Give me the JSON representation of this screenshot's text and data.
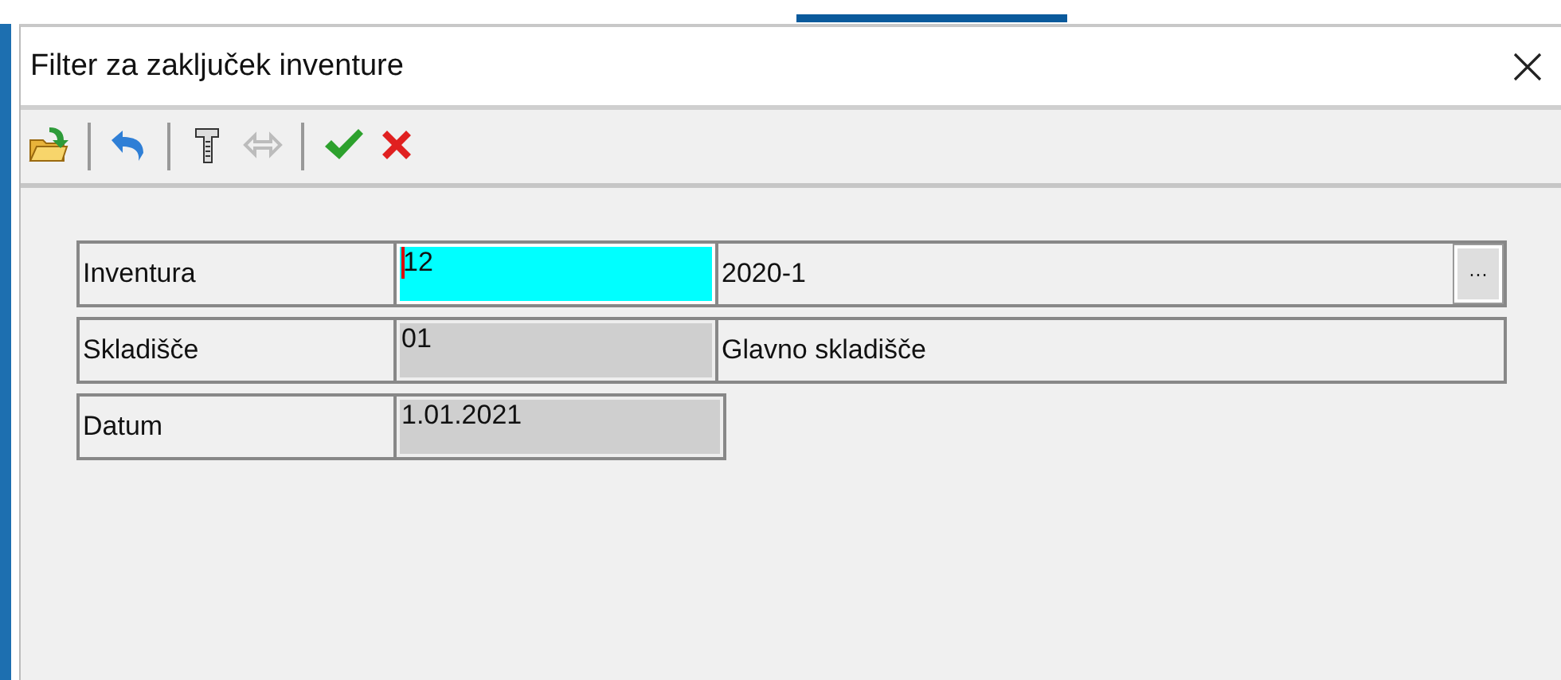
{
  "window": {
    "title": "Filter za zaključek inventure"
  },
  "toolbar": [
    [
      {
        "kind": "open",
        "disabled": false
      }
    ],
    [
      {
        "kind": "undo",
        "disabled": false
      }
    ],
    [
      {
        "kind": "tool",
        "disabled": false
      },
      {
        "kind": "link",
        "disabled": true
      }
    ],
    [
      {
        "kind": "confirm",
        "disabled": false
      },
      {
        "kind": "cancel",
        "disabled": false
      }
    ]
  ],
  "fields": [
    {
      "label": "Inventura",
      "code": "12",
      "focused": true,
      "disabled": false,
      "description": "2020-1",
      "lookup": "···"
    },
    {
      "label": "Skladišče",
      "code": "01",
      "focused": false,
      "disabled": true,
      "description": "Glavno skladišče"
    },
    {
      "label": "Datum",
      "code": "1.01.2021",
      "focused": false,
      "disabled": true
    }
  ]
}
